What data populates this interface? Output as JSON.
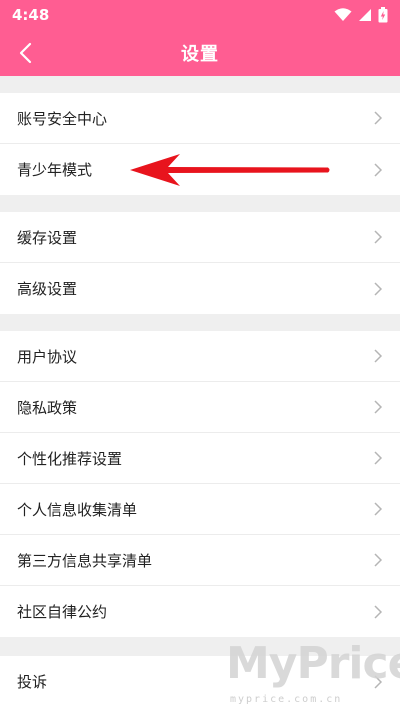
{
  "status_bar": {
    "time": "4:48"
  },
  "header": {
    "title": "设置"
  },
  "groups": [
    {
      "items": [
        {
          "label": "账号安全中心"
        },
        {
          "label": "青少年模式"
        }
      ]
    },
    {
      "items": [
        {
          "label": "缓存设置"
        },
        {
          "label": "高级设置"
        }
      ]
    },
    {
      "items": [
        {
          "label": "用户协议"
        },
        {
          "label": "隐私政策"
        },
        {
          "label": "个性化推荐设置"
        },
        {
          "label": "个人信息收集清单"
        },
        {
          "label": "第三方信息共享清单"
        },
        {
          "label": "社区自律公约"
        }
      ]
    },
    {
      "items": [
        {
          "label": "投诉"
        }
      ]
    }
  ],
  "watermark": {
    "brand": "MyPrice",
    "site": "myprice.com.cn"
  },
  "colors": {
    "header": "#ff5d92",
    "annotation_arrow": "#e8141d"
  },
  "icons": {
    "back": "chevron-left-icon",
    "row_arrow": "chevron-right-icon",
    "wifi": "wifi-icon",
    "signal": "signal-icon",
    "battery": "battery-icon"
  }
}
